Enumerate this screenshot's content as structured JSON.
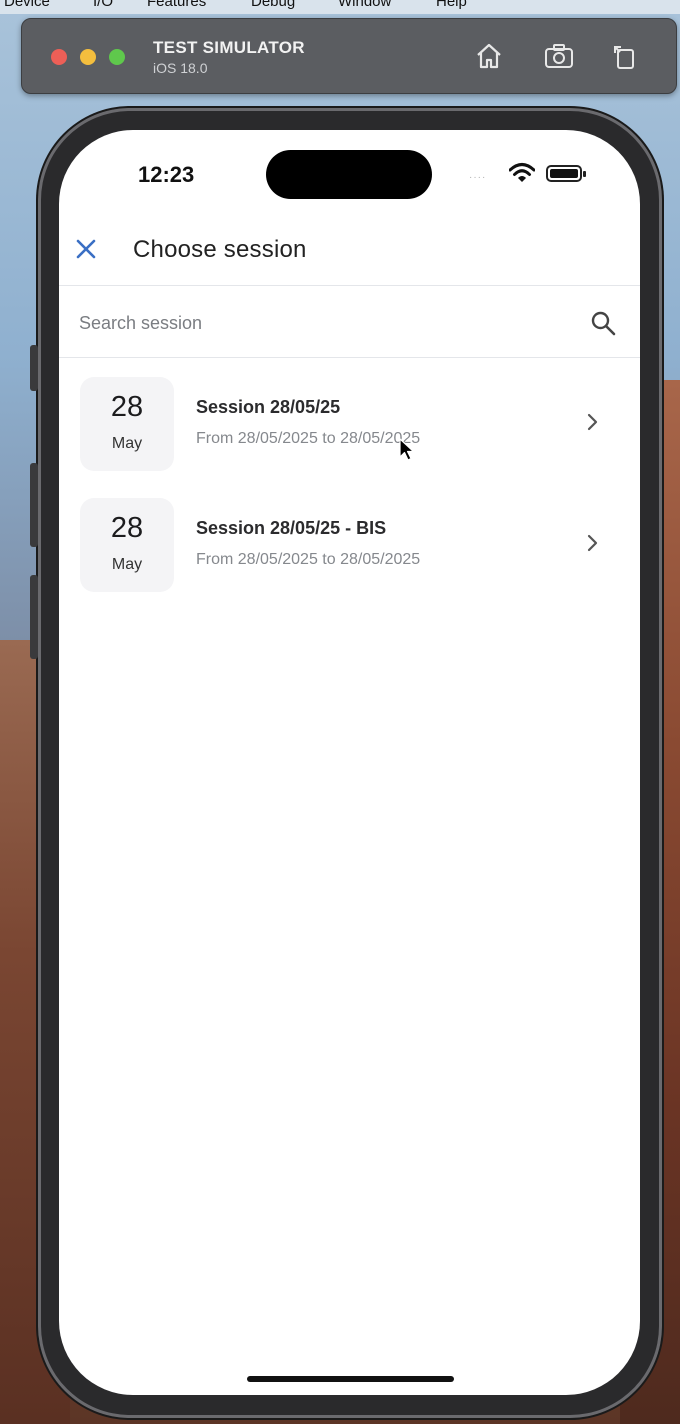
{
  "menubar": {
    "items": [
      "Device",
      "I/O",
      "Features",
      "Debug",
      "Window",
      "Help"
    ]
  },
  "simulator": {
    "title": "TEST SIMULATOR",
    "subtitle": "iOS 18.0",
    "icons": [
      "home-icon",
      "screenshot-icon",
      "rotate-icon"
    ]
  },
  "status_bar": {
    "time": "12:23",
    "signal": "····"
  },
  "nav": {
    "title": "Choose session",
    "close_icon": "close-icon"
  },
  "search": {
    "placeholder": "Search session",
    "value": ""
  },
  "sessions": [
    {
      "day": "28",
      "month": "May",
      "title": "Session 28/05/25",
      "range": "From 28/05/2025 to 28/05/2025"
    },
    {
      "day": "28",
      "month": "May",
      "title": "Session 28/05/25 - BIS",
      "range": "From 28/05/2025 to 28/05/2025"
    }
  ],
  "colors": {
    "accent": "#3a6fc4",
    "title_text": "#222222",
    "secondary_text": "#85888d",
    "date_tile_bg": "#f4f4f6"
  }
}
